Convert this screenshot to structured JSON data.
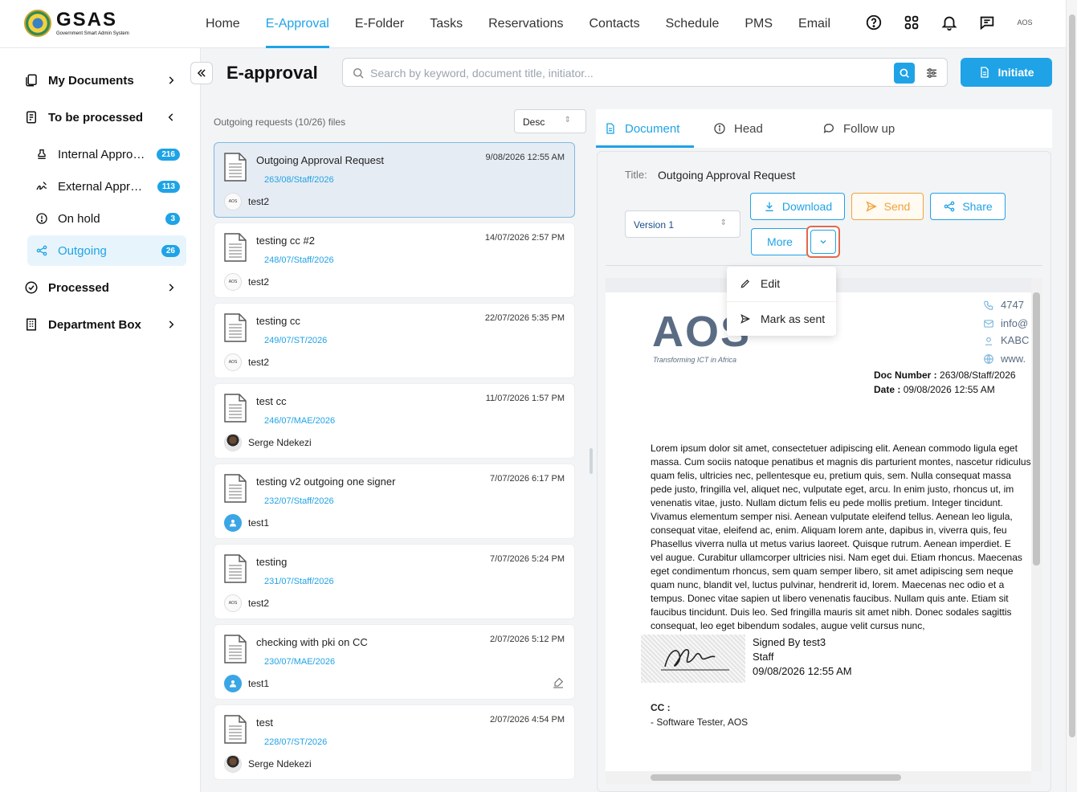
{
  "app": {
    "brand": "GSAS",
    "tagline": "Government Smart Admin System",
    "avatar_text": "AOS"
  },
  "nav": {
    "items": [
      "Home",
      "E-Approval",
      "E-Folder",
      "Tasks",
      "Reservations",
      "Contacts",
      "Schedule",
      "PMS",
      "Email"
    ],
    "active": "E-Approval"
  },
  "sidebar": {
    "my_documents": "My Documents",
    "to_be_processed": "To be processed",
    "internal": {
      "label": "Internal Approvals",
      "badge": "216"
    },
    "external": {
      "label": "External Approvals",
      "badge": "113"
    },
    "on_hold": {
      "label": "On hold",
      "badge": "3"
    },
    "outgoing": {
      "label": "Outgoing",
      "badge": "26"
    },
    "processed": "Processed",
    "department_box": "Department Box"
  },
  "header": {
    "title": "E-approval",
    "search_placeholder": "Search by keyword, document title, initiator...",
    "initiate_label": "Initiate"
  },
  "list": {
    "header": "Outgoing requests (10/26) files",
    "sort": "Desc",
    "items": [
      {
        "title": "Outgoing Approval Request",
        "ref": "263/08/Staff/2026",
        "date": "9/08/2026 12:55 AM",
        "user": "test2"
      },
      {
        "title": "testing cc #2",
        "ref": "248/07/Staff/2026",
        "date": "14/07/2026 2:57 PM",
        "user": "test2"
      },
      {
        "title": "testing cc",
        "ref": "249/07/ST/2026",
        "date": "22/07/2026 5:35 PM",
        "user": "test2"
      },
      {
        "title": "test cc",
        "ref": "246/07/MAE/2026",
        "date": "11/07/2026 1:57 PM",
        "user": "Serge Ndekezi"
      },
      {
        "title": "testing v2 outgoing one signer",
        "ref": "232/07/Staff/2026",
        "date": "7/07/2026 6:17 PM",
        "user": "test1"
      },
      {
        "title": "testing",
        "ref": "231/07/Staff/2026",
        "date": "7/07/2026 5:24 PM",
        "user": "test2"
      },
      {
        "title": "checking with pki on CC",
        "ref": "230/07/MAE/2026",
        "date": "2/07/2026 5:12 PM",
        "user": "test1"
      },
      {
        "title": "test",
        "ref": "228/07/ST/2026",
        "date": "2/07/2026 4:54 PM",
        "user": "Serge Ndekezi"
      }
    ]
  },
  "detail": {
    "tabs": [
      "Document",
      "Head",
      "Follow up"
    ],
    "title_label": "Title:",
    "title_value": "Outgoing Approval Request",
    "version": "Version 1",
    "download": "Download",
    "send": "Send",
    "share": "Share",
    "more": "More",
    "menu": {
      "edit": "Edit",
      "mark_as_sent": "Mark as sent"
    }
  },
  "document": {
    "logo": "AOS",
    "logo_tag": "Transforming ICT in Africa",
    "phone": "4747",
    "email": "info@",
    "address": "KABC",
    "web": "www.",
    "doc_number_label": "Doc  Number  :",
    "doc_number": "263/08/Staff/2026",
    "date_label": "Date  :",
    "date": "09/08/2026 12:55 AM",
    "body": "Lorem ipsum dolor sit amet, consectetuer adipiscing elit. Aenean commodo ligula eget\nmassa. Cum sociis natoque penatibus et magnis dis parturient montes, nascetur ridiculus\nquam felis, ultricies nec, pellentesque eu, pretium quis, sem. Nulla consequat massa\npede justo, fringilla vel, aliquet nec, vulputate eget, arcu. In enim justo, rhoncus ut, im\nvenenatis vitae, justo. Nullam dictum felis eu pede mollis pretium. Integer tincidunt.\nVivamus elementum semper nisi. Aenean vulputate eleifend tellus. Aenean leo ligula,\nconsequat vitae, eleifend ac, enim. Aliquam lorem ante, dapibus in, viverra quis, feu\nPhasellus viverra nulla ut metus varius laoreet. Quisque rutrum. Aenean imperdiet. E\nvel augue. Curabitur ullamcorper ultricies nisi. Nam eget dui. Etiam rhoncus. Maecenas\neget condimentum rhoncus, sem quam semper libero, sit amet adipiscing sem neque\nquam nunc, blandit vel, luctus pulvinar, hendrerit id, lorem. Maecenas nec odio et a\ntempus. Donec vitae sapien ut libero venenatis faucibus. Nullam quis ante. Etiam sit\nfaucibus tincidunt. Duis leo. Sed fringilla mauris sit amet nibh. Donec sodales sagittis\nconsequat, leo eget bibendum sodales, augue velit cursus nunc,",
    "signed_by": "Signed By  test3",
    "signer_role": "Staff",
    "signed_date": "09/08/2026 12:55 AM",
    "cc_label": "CC :",
    "cc_item": "-  Software Tester, AOS"
  }
}
